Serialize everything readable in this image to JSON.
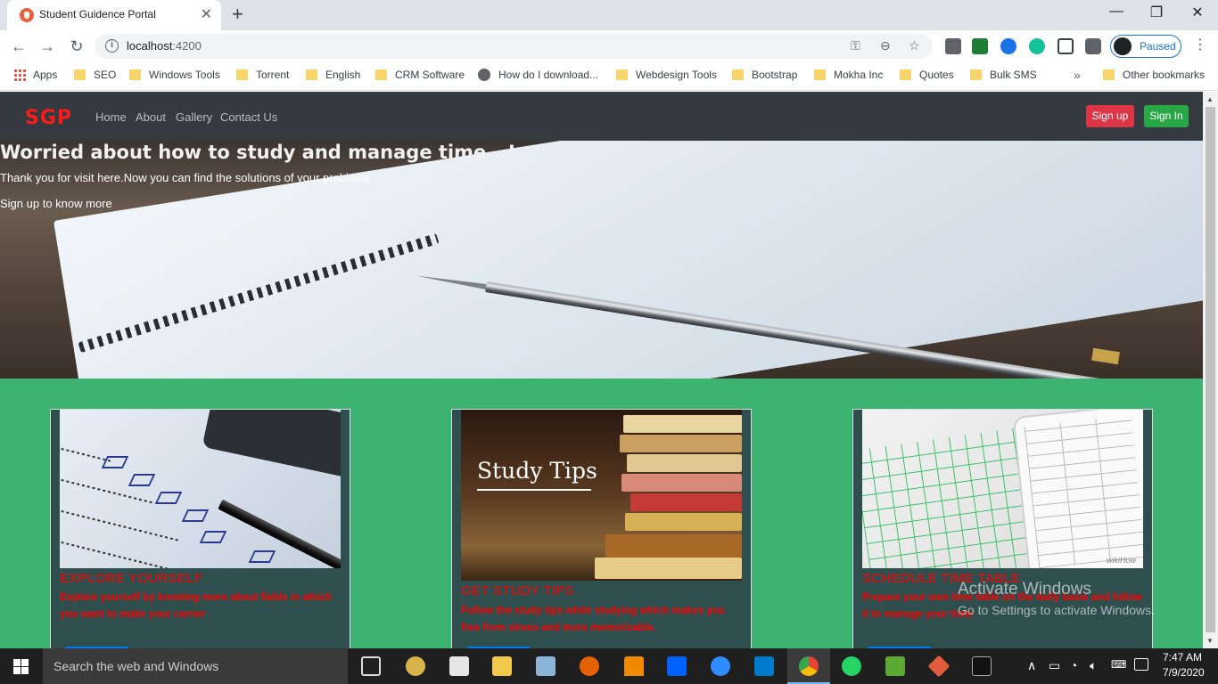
{
  "browser": {
    "tab_title": "Student Guidence Portal",
    "url_host": "localhost",
    "url_port": ":4200",
    "profile_label": "Paused",
    "bookmarks": [
      {
        "label": "Apps",
        "icon": "apps-icon"
      },
      {
        "label": "SEO",
        "icon": "folder-icon"
      },
      {
        "label": "Windows Tools",
        "icon": "folder-icon"
      },
      {
        "label": "Torrent",
        "icon": "folder-icon"
      },
      {
        "label": "English",
        "icon": "folder-icon"
      },
      {
        "label": "CRM Software",
        "icon": "folder-icon"
      },
      {
        "label": "How do I download...",
        "icon": "globe-icon"
      },
      {
        "label": "Webdesign Tools",
        "icon": "folder-icon"
      },
      {
        "label": "Bootstrap",
        "icon": "folder-icon"
      },
      {
        "label": "Mokha Inc",
        "icon": "folder-icon"
      },
      {
        "label": "Quotes",
        "icon": "folder-icon"
      },
      {
        "label": "Bulk SMS",
        "icon": "folder-icon"
      },
      {
        "label": "Other bookmarks",
        "icon": "folder-icon"
      }
    ],
    "more_bookmarks": "»"
  },
  "site": {
    "brand": "SGP",
    "nav": [
      "Home",
      "About",
      "Gallery",
      "Contact Us"
    ],
    "signup": "Sign up",
    "signin": "Sign In",
    "hero": {
      "title": "Worried about how to study and manage time...!",
      "text": "Thank you for visit here.Now you can find the solutions of your problems",
      "cta": "Sign up to know more"
    },
    "cards": [
      {
        "title": "EXPLORE YOURSELF",
        "text": "Explore yourself by knowing more about fields in which you want to make your carrier"
      },
      {
        "title": "GET STUDY TIPS",
        "text": "Follow the study tips while studying which makes you free from stress and more memorizable.",
        "image_caption": "Study Tips"
      },
      {
        "title": "SCHEDULE TIME TABLE",
        "text": "Prepare your own time table on the daily basis and follow it to manage your time.",
        "image_watermark": "wikiHow"
      }
    ]
  },
  "os": {
    "activate_title": "Activate Windows",
    "activate_sub": "Go to Settings to activate Windows.",
    "search_placeholder": "Search the web and Windows",
    "time": "7:47 AM",
    "date": "7/9/2020"
  },
  "colors": {
    "brand": "#ff1a1a",
    "navbar": "#343a40",
    "page_bg": "#3cb371",
    "card_bg": "#2f4f4f",
    "card_text": "#ff0000",
    "signup_btn": "#dc3545",
    "signin_btn": "#28a745"
  }
}
